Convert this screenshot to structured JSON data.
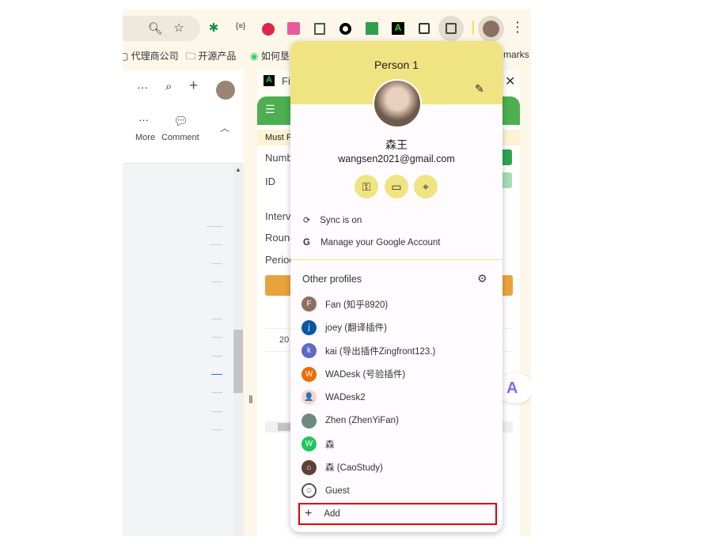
{
  "toolbar": {
    "extensions": [
      "puzzle-green",
      "json-viewer",
      "t-red",
      "translate-pink",
      "copy",
      "circle",
      "contact-green",
      "a-green",
      "extensions-puzzle",
      "side-panel"
    ],
    "menu": "⋮"
  },
  "bookmarks": [
    {
      "label": "代理商公司"
    },
    {
      "label": "开源产品"
    },
    {
      "label": "如何垦"
    },
    {
      "label": "marks"
    }
  ],
  "left_panel": {
    "more": "More",
    "comment": "Comment"
  },
  "right_panel": {
    "title": "Fi",
    "banner": "Must F",
    "fields": [
      "Numb",
      "ID",
      "Interv",
      "Round",
      "Period"
    ],
    "cell": "20"
  },
  "profile": {
    "header": "Person 1",
    "name": "森王",
    "email": "wangsen2021@gmail.com",
    "sync": "Sync is on",
    "manage": "Manage your Google Account",
    "other_profiles": "Other profiles",
    "profiles": [
      {
        "label": "Fan (知乎8920)",
        "initial": "F",
        "color": "#8d6e63"
      },
      {
        "label": "joey (翻译插件)",
        "initial": "j",
        "color": "#0b57a4"
      },
      {
        "label": "kai (导出插件Zingfront123.)",
        "initial": "k",
        "color": "#5c6bc0"
      },
      {
        "label": "WADesk (号验插件)",
        "initial": "W",
        "color": "#ef6c00"
      },
      {
        "label": "WADesk2",
        "initial": "👤",
        "color": "#fbd5c0"
      },
      {
        "label": "Zhen (ZhenYiFan)",
        "initial": "",
        "color": "#6d8b7a"
      },
      {
        "label": "森",
        "initial": "W",
        "color": "#22c55e"
      },
      {
        "label": "森 (CaoStudy)",
        "initial": "⌂",
        "color": "#5d4037"
      }
    ],
    "guest": "Guest",
    "add": "Add"
  },
  "colors": {
    "header": "#f0e482",
    "highlight": "#e00000"
  }
}
